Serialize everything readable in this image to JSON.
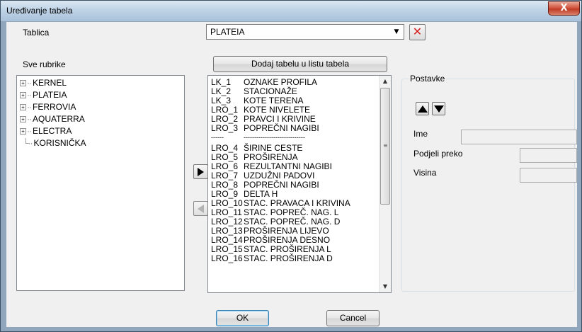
{
  "window": {
    "title": "Uređivanje tabela",
    "close_label": "X"
  },
  "tablica": {
    "label": "Tablica",
    "selected": "PLATEIA",
    "dropdown_icon": "chevron-down-icon",
    "delete_icon": "red-x-icon",
    "delete_glyph": "✕"
  },
  "sve_rubrike": {
    "label": "Sve rubrike",
    "items": [
      {
        "label": "KERNEL",
        "expandable": true
      },
      {
        "label": "PLATEIA",
        "expandable": true
      },
      {
        "label": "FERROVIA",
        "expandable": true
      },
      {
        "label": "AQUATERRA",
        "expandable": true
      },
      {
        "label": "ELECTRA",
        "expandable": true
      },
      {
        "label": "KORISNIČKA",
        "expandable": false
      }
    ]
  },
  "add_button": {
    "label": "Dodaj tabelu u listu tabela"
  },
  "table_list": {
    "rows": [
      {
        "code": "LK_1",
        "name": "OZNAKE PROFILA"
      },
      {
        "code": "LK_2",
        "name": "STACIONAŽE"
      },
      {
        "code": "LK_3",
        "name": "KOTE TERENA"
      },
      {
        "code": "LRO_1",
        "name": "KOTE NIVELETE"
      },
      {
        "code": "LRO_2",
        "name": "PRAVCI I KRIVINE"
      },
      {
        "code": "LRO_3",
        "name": "POPREČNI NAGIBI"
      },
      {
        "code": "------",
        "name": "-----------------------------"
      },
      {
        "code": "LRO_4",
        "name": "ŠIRINE CESTE"
      },
      {
        "code": "LRO_5",
        "name": "PROŠIRENJA"
      },
      {
        "code": "LRO_6",
        "name": "REZULTANTNI NAGIBI"
      },
      {
        "code": "LRO_7",
        "name": "UZDUŽNI PADOVI"
      },
      {
        "code": "LRO_8",
        "name": "POPREČNI NAGIBI"
      },
      {
        "code": "LRO_9",
        "name": "DELTA H"
      },
      {
        "code": "LRO_10",
        "name": "STAC. PRAVACA I KRIVINA"
      },
      {
        "code": "LRO_11",
        "name": "STAC. POPREČ. NAG. L"
      },
      {
        "code": "LRO_12",
        "name": "STAC. POPREČ. NAG. D"
      },
      {
        "code": "LRO_13",
        "name": "PROŠIRENJA LIJEVO"
      },
      {
        "code": "LRO_14",
        "name": "PROŠIRENJA DESNO"
      },
      {
        "code": "LRO_15",
        "name": "STAC. PROŠIRENJA L"
      },
      {
        "code": "LRO_16",
        "name": "STAC. PROŠIRENJA D"
      }
    ]
  },
  "move_buttons": {
    "right_icon": "arrow-right-icon",
    "left_icon": "arrow-left-icon"
  },
  "postavke": {
    "label": "Postavke",
    "up_icon": "arrow-up-icon",
    "down_icon": "arrow-down-icon",
    "ime_label": "Ime",
    "ime_value": "",
    "podjeli_label": "Podjeli preko",
    "podjeli_value": "",
    "visina_label": "Visina",
    "visina_value": ""
  },
  "footer": {
    "ok_label": "OK",
    "cancel_label": "Cancel"
  }
}
